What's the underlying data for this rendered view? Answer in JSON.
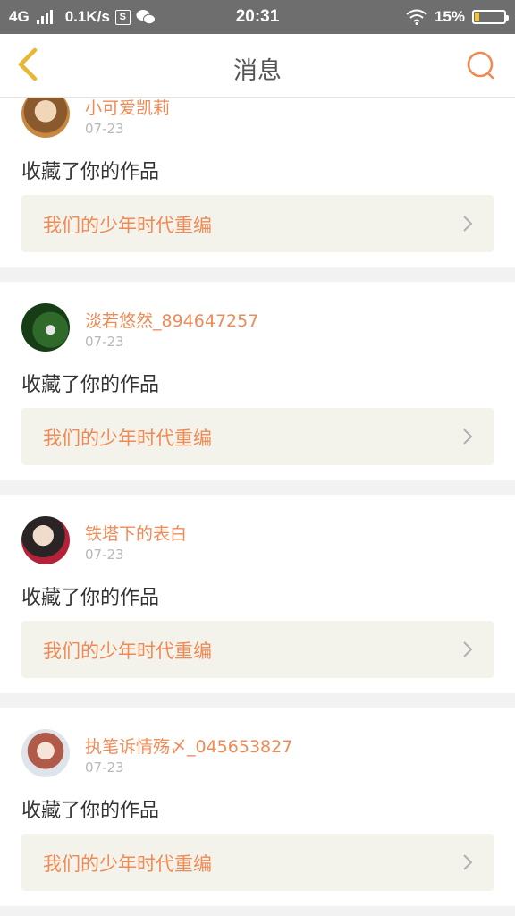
{
  "status_bar": {
    "network": "4G",
    "speed": "0.1K/s",
    "time": "20:31",
    "battery": "15%",
    "battery_level": 0.15,
    "icons": [
      "signal-icon",
      "s-app-icon",
      "wechat-icon",
      "wifi-icon",
      "battery-icon"
    ]
  },
  "header": {
    "title": "消息",
    "back_icon": "chevron-left-icon",
    "search_icon": "search-icon"
  },
  "colors": {
    "accent": "#f08a55",
    "back_arrow": "#e8b630",
    "card_bg": "#f3f3ec",
    "separator": "#f2f2f2"
  },
  "messages": [
    {
      "name": "小可爱凯莉",
      "date": "07-23",
      "action": "收藏了你的作品",
      "work": "我们的少年时代重编"
    },
    {
      "name": "淡若悠然_894647257",
      "date": "07-23",
      "action": "收藏了你的作品",
      "work": "我们的少年时代重编"
    },
    {
      "name": "铁塔下的表白",
      "date": "07-23",
      "action": "收藏了你的作品",
      "work": "我们的少年时代重编"
    },
    {
      "name": "执笔诉情殇〆_045653827",
      "date": "07-23",
      "action": "收藏了你的作品",
      "work": "我们的少年时代重编"
    }
  ]
}
